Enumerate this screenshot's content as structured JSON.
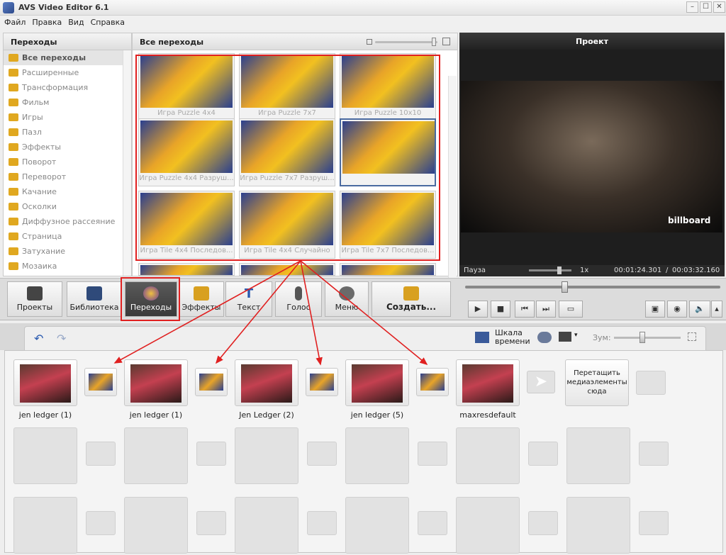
{
  "window": {
    "title": "AVS Video Editor 6.1"
  },
  "menu": [
    "Файл",
    "Правка",
    "Вид",
    "Справка"
  ],
  "categories": {
    "header": "Переходы",
    "items": [
      "Все переходы",
      "Расширенные",
      "Трансформация",
      "Фильм",
      "Игры",
      "Пазл",
      "Эффекты",
      "Поворот",
      "Переворот",
      "Качание",
      "Осколки",
      "Диффузное рассеяние",
      "Страница",
      "Затухание",
      "Мозаика"
    ]
  },
  "gallery": {
    "header": "Все переходы",
    "items": [
      "Игра Puzzle 4x4",
      "Игра Puzzle 7x7",
      "Игра Puzzle 10x10",
      "Игра Puzzle 4x4 Разруш...",
      "Игра Puzzle 7x7 Разруш...",
      "",
      "Игра Tile 4x4 Последов...",
      "Игра Tile 4x4 Случайно",
      "Игра Tile 7x7 Последов..."
    ]
  },
  "preview": {
    "header": "Проект",
    "watermark": "billboard",
    "status": "Пауза",
    "speed": "1x",
    "current_time": "00:01:24.301",
    "total_time": "00:03:32.160"
  },
  "toolbar": {
    "projects": "Проекты",
    "library": "Библиотека",
    "transitions": "Переходы",
    "effects": "Эффекты",
    "text": "Текст",
    "voice": "Голос",
    "menu": "Меню",
    "create": "Создать..."
  },
  "timeline": {
    "scale_label": "Шкала времени",
    "zoom_label": "Зум:"
  },
  "storyboard": {
    "clips": [
      "jen ledger (1)",
      "jen ledger (1)",
      "Jen Ledger (2)",
      "jen ledger (5)",
      "maxresdefault"
    ],
    "drop_hint": "Перетащить медиаэлементы сюда"
  },
  "colors": {
    "annotation": "#e02020",
    "active_tab": "#3f3f3f",
    "transition_blue": "#2a3f8f",
    "transition_gold": "#e8a428"
  }
}
